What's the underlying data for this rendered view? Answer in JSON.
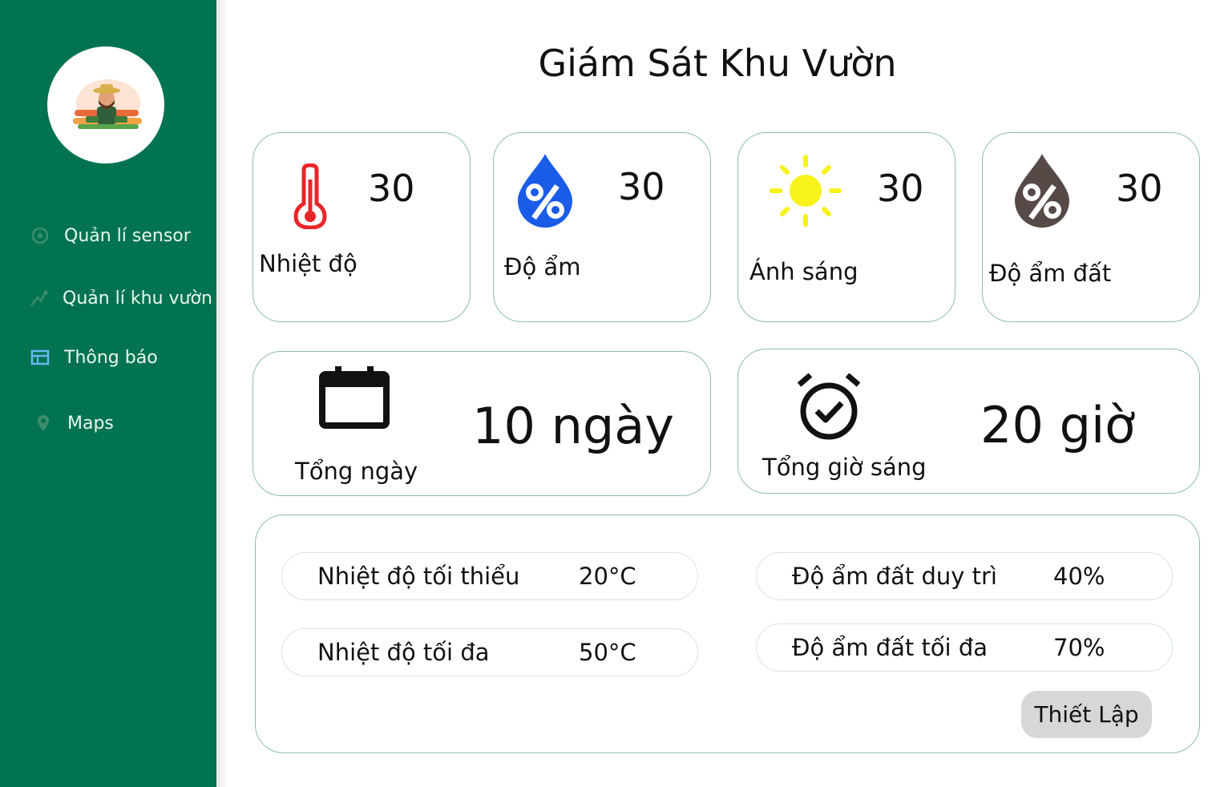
{
  "sidebar": {
    "items": [
      {
        "label": "Quản lí sensor",
        "icon": "sensor-icon"
      },
      {
        "label": "Quản lí khu vườn",
        "icon": "garden-icon"
      },
      {
        "label": "Thông báo",
        "icon": "notification-icon"
      },
      {
        "label": "Maps",
        "icon": "map-pin-icon"
      }
    ]
  },
  "header": {
    "title": "Giám Sát Khu Vườn"
  },
  "metrics": [
    {
      "label": "Nhiệt độ",
      "value": "30",
      "icon": "thermometer-icon",
      "color": "#e8262a"
    },
    {
      "label": "Độ ẩm",
      "value": "30",
      "icon": "humidity-drop-icon",
      "color": "#1a5ce8"
    },
    {
      "label": "Ánh sáng",
      "value": "30",
      "icon": "sun-icon",
      "color": "#f6f21a"
    },
    {
      "label": "Độ ẩm đất",
      "value": "30",
      "icon": "soil-moisture-drop-icon",
      "color": "#564a47"
    }
  ],
  "summary": [
    {
      "label": "Tổng ngày",
      "value": "10 ngày",
      "icon": "calendar-icon"
    },
    {
      "label": "Tổng giờ sáng",
      "value": "20 giờ",
      "icon": "alarm-clock-icon"
    }
  ],
  "settings": {
    "rows": [
      {
        "label": "Nhiệt độ tối thiểu",
        "value": "20°C"
      },
      {
        "label": "Nhiệt độ tối đa",
        "value": "50°C"
      },
      {
        "label": "Độ ẩm đất duy trì",
        "value": "40%"
      },
      {
        "label": "Độ ẩm đất tối đa",
        "value": "70%"
      }
    ],
    "button_label": "Thiết Lập"
  },
  "colors": {
    "sidebar": "#017351",
    "card_border": "#8dbfa8",
    "button": "#d7d7d7"
  }
}
